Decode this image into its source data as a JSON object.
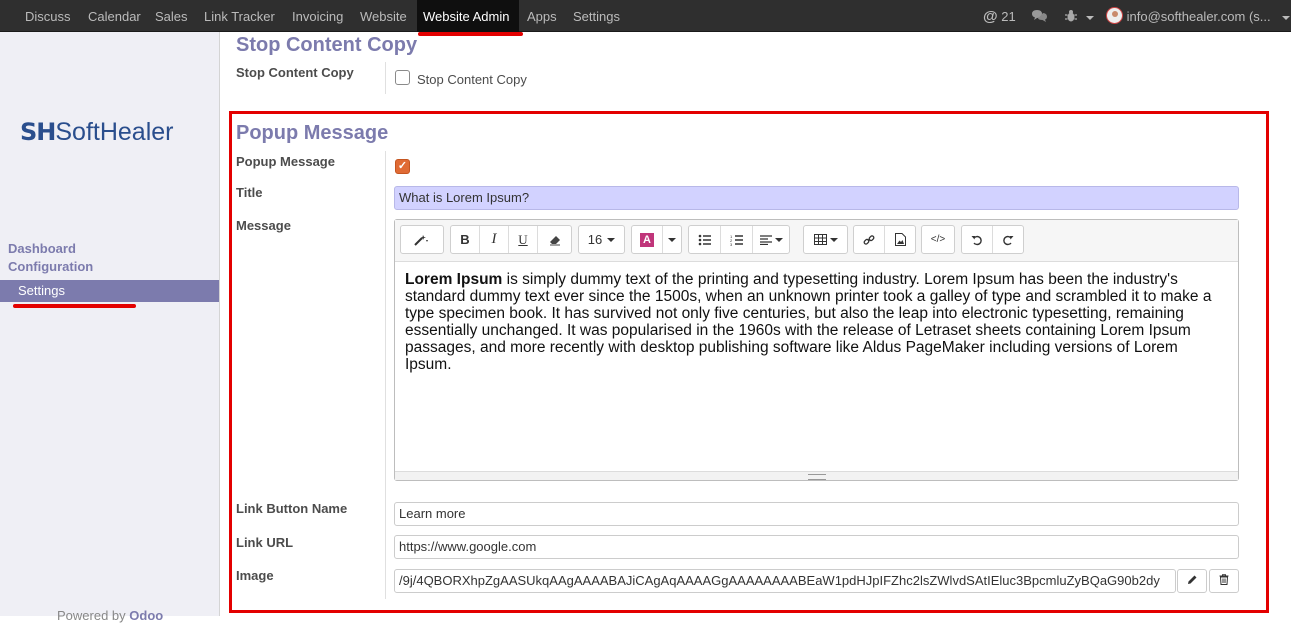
{
  "navbar": {
    "items": [
      "Discuss",
      "Calendar",
      "Sales",
      "Link Tracker",
      "Invoicing",
      "Website",
      "Website Admin",
      "Apps",
      "Settings"
    ],
    "notif_count": "21",
    "user": "info@softhealer.com (s..."
  },
  "sidebar": {
    "logo_mark": "SH",
    "logo_text": "SoftHealer",
    "dashboard": "Dashboard",
    "configuration": "Configuration",
    "settings": "Settings",
    "powered_prefix": "Powered by",
    "powered_brand": "Odoo"
  },
  "stop_copy": {
    "section_title": "Stop Content Copy",
    "label": "Stop Content Copy",
    "checkbox_label": "Stop Content Copy"
  },
  "popup": {
    "section_title": "Popup Message",
    "popup_label": "Popup Message",
    "title_label": "Title",
    "title_value": "What is Lorem Ipsum?",
    "message_label": "Message",
    "font_size": "16",
    "message_bold": "Lorem Ipsum",
    "message_rest": " is simply dummy text of the printing and typesetting industry. Lorem Ipsum has been the industry's standard dummy text ever since the 1500s, when an unknown printer took a galley of type and scrambled it to make a type specimen book. It has survived not only five centuries, but also the leap into electronic typesetting, remaining essentially unchanged. It was popularised in the 1960s with the release of Letraset sheets containing Lorem Ipsum passages, and more recently with desktop publishing software like Aldus PageMaker including versions of Lorem Ipsum.",
    "link_button_label": "Link Button Name",
    "link_button_value": "Learn more",
    "link_url_label": "Link URL",
    "link_url_value": "https://www.google.com",
    "image_label": "Image",
    "image_value": "/9j/4QBORXhpZgAASUkqAAgAAAABAJiCAgAqAAAAGgAAAAAAAABEaW1pdHJpIFZhc2lsZWlvdSAtIEluc3BpcmluZyBQaG90b2dy"
  },
  "colors": {
    "accent": "#7c7bad",
    "highlight": "#e30000",
    "checkbox": "#e06b35"
  }
}
